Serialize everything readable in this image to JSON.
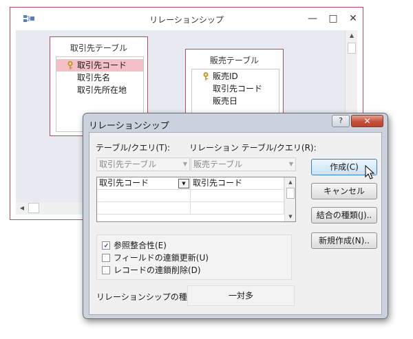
{
  "background_window": {
    "title": "リレーションシップ",
    "minimize_glyph": "—",
    "maximize_glyph": "□",
    "close_glyph": "✕",
    "tables": [
      {
        "name": "取引先テーブル",
        "fields": [
          "取引先コード",
          "取引先名",
          "取引先所在地"
        ]
      },
      {
        "name": "販売テーブル",
        "fields": [
          "販売ID",
          "取引先コード",
          "販売日"
        ]
      }
    ]
  },
  "dialog": {
    "title": "リレーションシップ",
    "help_glyph": "?",
    "close_glyph": "✕",
    "table_query_label": "テーブル/クエリ(T):",
    "related_table_query_label": "リレーション テーブル/クエリ(R):",
    "table_combo_value": "取引先テーブル",
    "related_combo_value": "販売テーブル",
    "field_rows": [
      {
        "left": "取引先コード",
        "right": "取引先コード"
      }
    ],
    "buttons": {
      "create": "作成(C)",
      "cancel": "キャンセル",
      "join_type": "結合の種類(J)..",
      "new": "新規作成(N).."
    },
    "options": {
      "referential_integrity": "参照整合性(E)",
      "cascade_update": "フィールドの連鎖更新(U)",
      "cascade_delete": "レコードの連鎖削除(D)",
      "referential_integrity_checked": true,
      "cascade_update_checked": false,
      "cascade_delete_checked": false
    },
    "relationship_type_label": "リレーションシップの種類",
    "relationship_type_value": "一対多"
  }
}
